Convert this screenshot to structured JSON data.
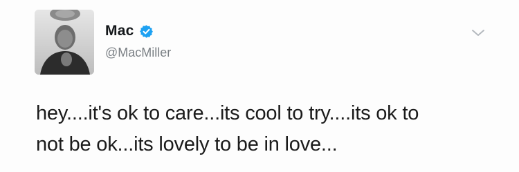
{
  "author": {
    "display_name": "Mac",
    "handle": "@MacMiller",
    "verified": true,
    "verified_color": "#1da1f2"
  },
  "tweet": {
    "lines": [
      "hey....it's ok to care...its cool to try....its ok to",
      "not be ok...its lovely to be in love..."
    ]
  },
  "icons": {
    "verified": "verified-badge-icon",
    "menu": "chevron-down-icon"
  }
}
